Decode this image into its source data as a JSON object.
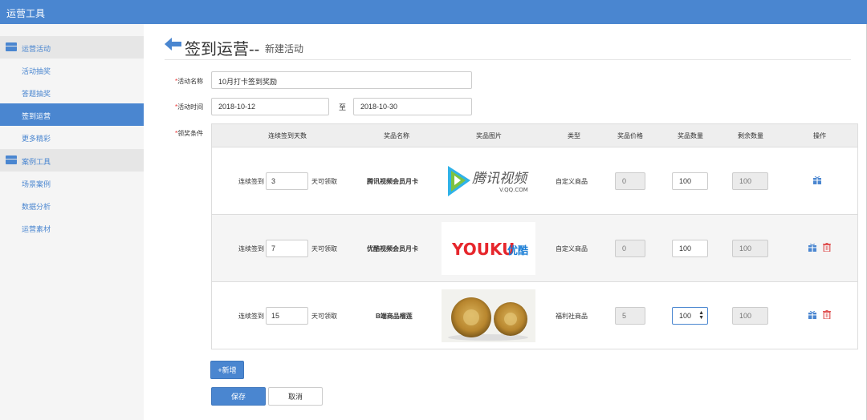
{
  "app": {
    "title": "运营工具"
  },
  "sidebar": {
    "groups": [
      {
        "label": "运营活动",
        "icon": "gift-icon",
        "items": [
          "活动抽奖",
          "答题抽奖",
          "签到运营",
          "更多精彩"
        ]
      },
      {
        "label": "案例工具",
        "icon": "briefcase-icon",
        "items": [
          "场景案例",
          "数据分析",
          "运营素材"
        ]
      }
    ],
    "active_item": "签到运营"
  },
  "page": {
    "title": "签到运营--",
    "subtitle": "新建活动"
  },
  "form": {
    "name_label": "活动名称",
    "name_value": "10月打卡签到奖励",
    "time_label": "活动时间",
    "start_date": "2018-10-12",
    "to_text": "至",
    "end_date": "2018-10-30",
    "rules_label": "领奖条件",
    "required_mark": "*"
  },
  "table": {
    "headers": [
      "连续签到天数",
      "奖品名称",
      "奖品图片",
      "类型",
      "奖品价格",
      "奖品数量",
      "剩余数量",
      "操作"
    ],
    "rows": [
      {
        "prefix": "连续签到",
        "days": "3",
        "suffix": "天可领取",
        "name": "腾讯视频会员月卡",
        "image": "腾讯视频 V.QQ.COM logo",
        "logo_text": "腾讯视频",
        "logo_sub": "V.QQ.COM",
        "type": "自定义商品",
        "price": "0",
        "qty": "100",
        "remaining": "100",
        "actions": [
          "gift-icon"
        ]
      },
      {
        "prefix": "连续签到",
        "days": "7",
        "suffix": "天可领取",
        "name": "优酷视频会员月卡",
        "image": "YOUKU优酷 logo",
        "logo_text": "YOUKU",
        "logo_sub": "优酷",
        "type": "自定义商品",
        "price": "0",
        "qty": "100",
        "remaining": "100",
        "actions": [
          "gift-icon",
          "trash-icon"
        ]
      },
      {
        "prefix": "连续签到",
        "days": "15",
        "suffix": "天可领取",
        "name": "B端商品榴莲",
        "image": "durian photo",
        "type": "福利社商品",
        "price": "5",
        "qty": "100",
        "remaining": "100",
        "actions": [
          "gift-icon",
          "trash-icon"
        ]
      }
    ]
  },
  "buttons": {
    "add": "+新增",
    "save": "保存",
    "cancel": "取消"
  },
  "colors": {
    "primary": "#4a86d0",
    "required": "#e33333",
    "danger": "#e05555"
  }
}
